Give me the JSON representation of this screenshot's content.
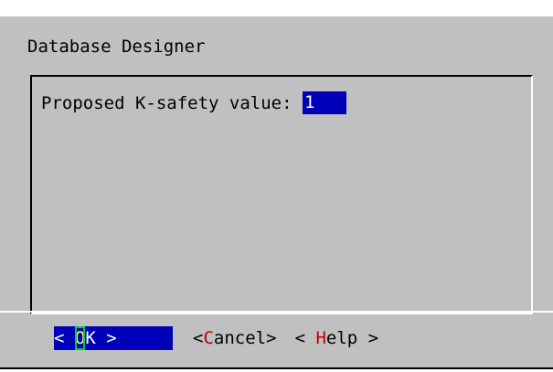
{
  "dialog": {
    "title": "Database Designer",
    "prompt_label": "Proposed K-safety value: ",
    "k_safety_value": "1"
  },
  "buttons": {
    "ok": {
      "left": "< ",
      "hotkey": "O",
      "rest": "K",
      "right": " >"
    },
    "cancel": {
      "left": "<",
      "hotkey": "C",
      "rest": "ancel",
      "right": ">"
    },
    "help": {
      "left": "< ",
      "hotkey": "H",
      "rest": "elp",
      "right": " >"
    }
  },
  "colors": {
    "background": "#c0c0c0",
    "highlight": "#0000b8",
    "hotkey": "#c00000",
    "focus_outline": "#00cc33"
  }
}
